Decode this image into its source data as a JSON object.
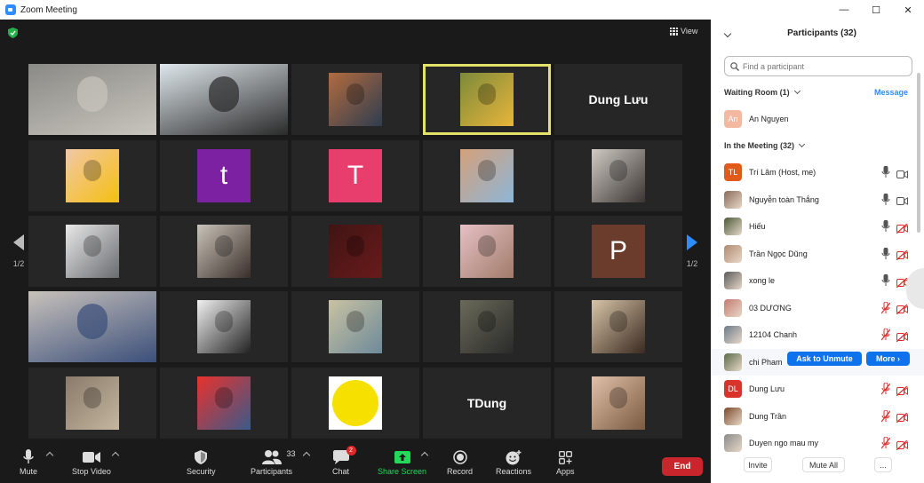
{
  "window": {
    "title": "Zoom Meeting",
    "minimize": "—",
    "maximize": "☐",
    "close": "✕"
  },
  "meeting": {
    "view_label": "View",
    "page_left": "1/2",
    "page_right": "1/2",
    "tiles": [
      {
        "kind": "video",
        "color": "#8a8a86",
        "color2": "#c9c5be"
      },
      {
        "kind": "video",
        "color": "#dfe7ec",
        "color2": "#2a2a2a"
      },
      {
        "kind": "avatar",
        "color": "#b36b3e",
        "color2": "#2e3d50"
      },
      {
        "kind": "avatar",
        "color": "#7d8a3a",
        "color2": "#e8b53a",
        "active": true
      },
      {
        "kind": "name",
        "name": "Dung Lưu"
      },
      {
        "kind": "avatar",
        "color": "#f3c7a5",
        "color2": "#f4c010"
      },
      {
        "kind": "letter",
        "letter": "t",
        "color": "#7b21a2"
      },
      {
        "kind": "letter",
        "letter": "T",
        "color": "#e83e6e"
      },
      {
        "kind": "avatar",
        "color": "#d4a07a",
        "color2": "#8db6d8"
      },
      {
        "kind": "avatar",
        "color": "#cfcac4",
        "color2": "#3a3532"
      },
      {
        "kind": "avatar",
        "color": "#e8e8e8",
        "color2": "#6a6b70"
      },
      {
        "kind": "avatar",
        "color": "#c9c3b8",
        "color2": "#3a2e2a"
      },
      {
        "kind": "avatar",
        "color": "#401414",
        "color2": "#6a1a1a"
      },
      {
        "kind": "avatar",
        "color": "#e6c0c4",
        "color2": "#a07c6a"
      },
      {
        "kind": "letter",
        "letter": "P",
        "color": "#6b3b2b"
      },
      {
        "kind": "video",
        "color": "#c8c2bb",
        "color2": "#3b4f7a"
      },
      {
        "kind": "avatar",
        "color": "#f0f0f0",
        "color2": "#222222"
      },
      {
        "kind": "avatar",
        "color": "#c9c2a2",
        "color2": "#6d8a9a"
      },
      {
        "kind": "avatar",
        "color": "#6a6a5a",
        "color2": "#2a2a2a"
      },
      {
        "kind": "avatar",
        "color": "#d8c4a8",
        "color2": "#3a2a20"
      },
      {
        "kind": "avatar",
        "color": "#8a7a6a",
        "color2": "#c4b6a0"
      },
      {
        "kind": "avatar",
        "color": "#e8322c",
        "color2": "#3a5a8a"
      },
      {
        "kind": "logo",
        "color": "#ffffff",
        "color2": "#f5e000"
      },
      {
        "kind": "name",
        "name": "TDung"
      },
      {
        "kind": "avatar",
        "color": "#e0c0a8",
        "color2": "#7a5a40"
      }
    ]
  },
  "toolbar": {
    "mute": "Mute",
    "stop_video": "Stop Video",
    "security": "Security",
    "participants": "Participants",
    "participants_count": "33",
    "chat": "Chat",
    "chat_badge": "2",
    "share_screen": "Share Screen",
    "record": "Record",
    "reactions": "Reactions",
    "apps": "Apps",
    "end": "End"
  },
  "panel": {
    "title": "Participants (32)",
    "search_placeholder": "Find a participant",
    "waiting_room": "Waiting Room (1)",
    "message": "Message",
    "waiting": [
      {
        "name": "An Nguyen",
        "initials": "An",
        "color": "#f4b8a0"
      }
    ],
    "in_meeting": "In the Meeting (32)",
    "participants": [
      {
        "name": "Trí Lâm (Host, me)",
        "initials": "TL",
        "color": "#e05a1a",
        "mic": "on",
        "cam": "on"
      },
      {
        "name": "Nguyễn toàn Thắng",
        "color": "#8a6a5a",
        "mic": "on",
        "cam": "on"
      },
      {
        "name": "Hiếu",
        "color": "#4a5a3a",
        "mic": "on",
        "cam": "off"
      },
      {
        "name": "Trần Ngọc Dũng",
        "color": "#b08a70",
        "mic": "on",
        "cam": "off"
      },
      {
        "name": "xong le",
        "color": "#5a5a5a",
        "mic": "on",
        "cam": "off"
      },
      {
        "name": "03 DƯƠNG",
        "color": "#c47a70",
        "mic": "off",
        "cam": "off"
      },
      {
        "name": "12104 Chanh",
        "color": "#6a7a8a",
        "mic": "off",
        "cam": "off"
      },
      {
        "name": "chi Pham",
        "color": "#5a6a4a",
        "mic": "off",
        "cam": "off",
        "hover": true
      },
      {
        "name": "Dung Lưu",
        "initials": "DL",
        "color": "#d9342b",
        "mic": "off",
        "cam": "off"
      },
      {
        "name": "Dung Trần",
        "color": "#7a4a2a",
        "mic": "off",
        "cam": "off"
      },
      {
        "name": "Duyen ngo mau my",
        "color": "#8a8a8a",
        "mic": "off",
        "cam": "off"
      }
    ],
    "ask_to_unmute": "Ask to Unmute",
    "more": "More ›",
    "invite": "Invite",
    "mute_all": "Mute All",
    "more_options": "..."
  }
}
